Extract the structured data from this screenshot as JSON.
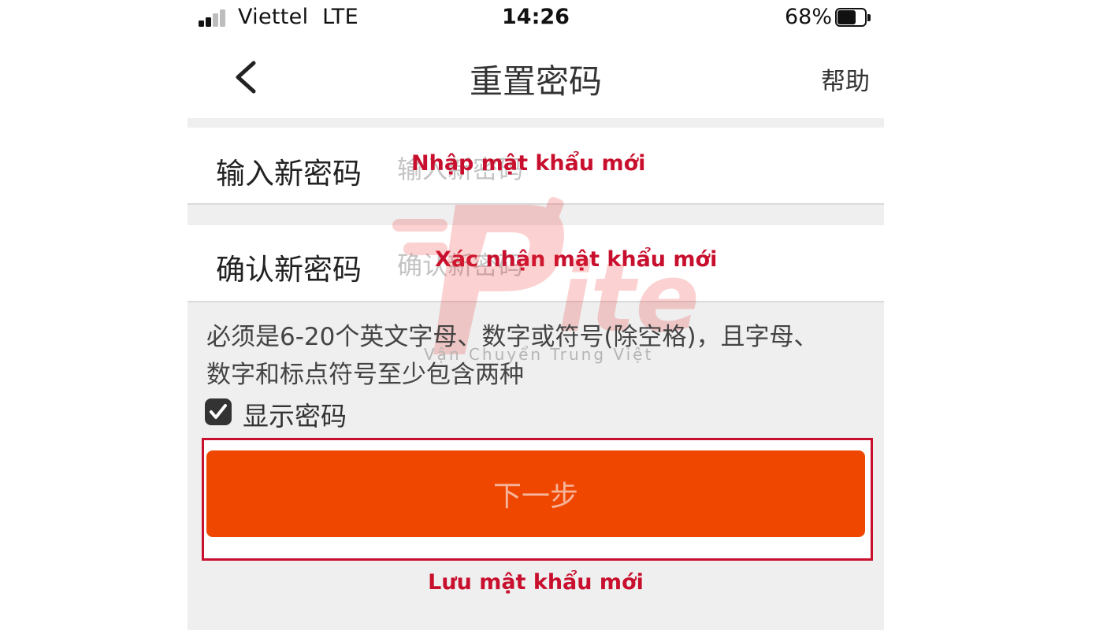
{
  "status_bar": {
    "carrier": "Viettel",
    "network": "LTE",
    "time": "14:26",
    "battery_percent": "68%",
    "battery_level": 0.68,
    "signal_bars_filled": 2,
    "signal_bars_total": 4
  },
  "nav": {
    "back_icon": "chevron-left-icon",
    "title": "重置密码",
    "help": "帮助"
  },
  "form": {
    "new_password": {
      "label": "输入新密码",
      "placeholder": "输入新密码",
      "annotation": "Nhập mật khẩu mới"
    },
    "confirm_password": {
      "label": "确认新密码",
      "placeholder": "确认新密码",
      "annotation": "Xác nhận mật khẩu mới"
    },
    "hint_line1": "必须是6-20个英文字母、数字或符号(除空格)，且字母、",
    "hint_line2": "数字和标点符号至少包含两种",
    "show_password": {
      "label": "显示密码",
      "checked": true
    },
    "next_button": "下一步",
    "save_annotation": "Lưu mật khẩu mới"
  },
  "watermark": {
    "text": "Ptite",
    "subtitle": "Vận Chuyển Trung Việt"
  },
  "colors": {
    "accent": "#ef4700",
    "annotation": "#c8102e",
    "background": "#efefef"
  }
}
